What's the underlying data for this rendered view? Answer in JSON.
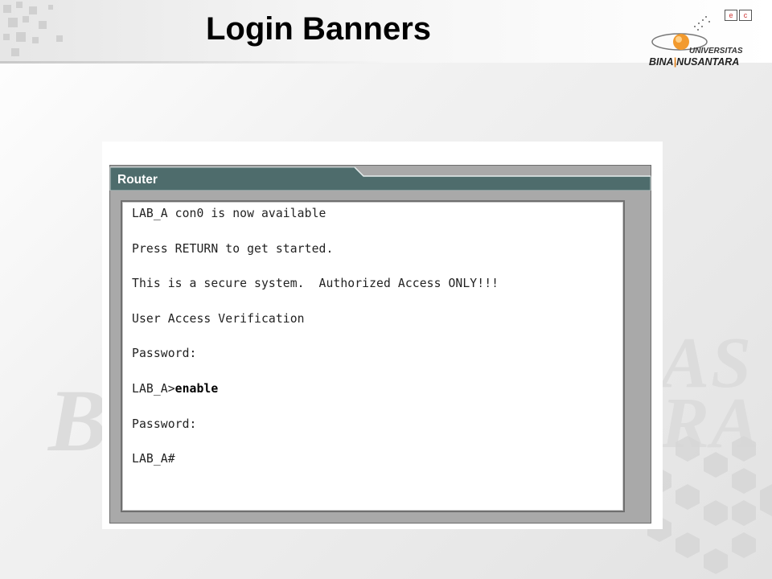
{
  "slide": {
    "title": "Login Banners"
  },
  "logo": {
    "universitas": "UNIVERSITAS",
    "bina": "BINA",
    "nusantara": "NUSANTARA"
  },
  "window": {
    "title": "Router",
    "header_color": "#4e6c6c"
  },
  "terminal": {
    "lines": [
      {
        "text": "LAB_A con0 is now available",
        "bold": ""
      },
      {
        "text": "Press RETURN to get started.",
        "bold": ""
      },
      {
        "text": "This is a secure system.  Authorized Access ONLY!!!",
        "bold": ""
      },
      {
        "text": "User Access Verification",
        "bold": ""
      },
      {
        "text": "Password:",
        "bold": ""
      },
      {
        "text": "LAB_A>",
        "bold": "enable"
      },
      {
        "text": "Password:",
        "bold": ""
      },
      {
        "text": "LAB_A#",
        "bold": ""
      }
    ]
  },
  "watermark": {
    "line1": "AS",
    "line2": "B",
    "line3": "RA"
  }
}
